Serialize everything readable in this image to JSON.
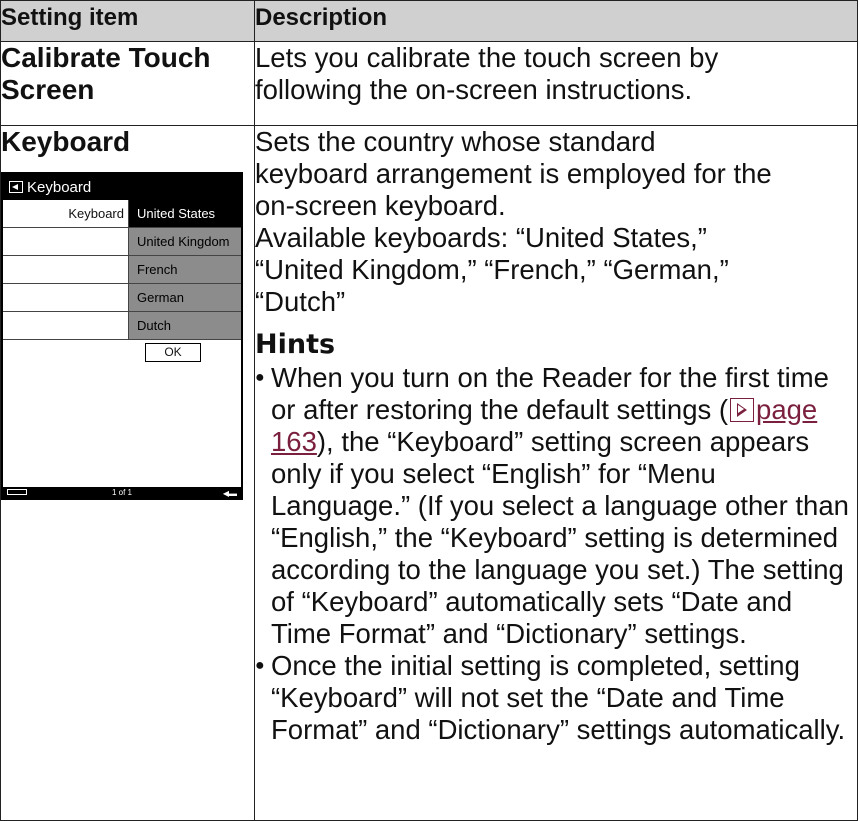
{
  "table": {
    "headers": {
      "item": "Setting item",
      "description": "Description"
    },
    "rows": [
      {
        "item_title": "Calibrate Touch Screen",
        "description_lines": [
          "Lets you calibrate the touch screen by",
          "following the on-screen instructions."
        ]
      },
      {
        "item_title": "Keyboard",
        "description_lines": [
          "Sets the country whose standard",
          "keyboard arrangement is employed for the",
          "on-screen keyboard.",
          "Available keyboards: “United States,”",
          "“United Kingdom,” “French,” “German,”",
          "“Dutch”"
        ],
        "hints_heading": "Hints",
        "hints": {
          "first": {
            "before_link": "When you turn on the Reader for the first time or after restoring the default settings (",
            "link": "page 163",
            "after_link": "), the “Keyboard” setting screen appears only if you select “English” for “Menu Language.” (If you select a language other than “English,” the “Keyboard” setting is determined according to the language you set.) The setting of “Keyboard” automatically sets “Date and Time Format” and “Dictionary” settings."
          },
          "second": "Once the initial setting is completed, setting “Keyboard” will not set the “Date and Time Format” and “Dictionary” settings automatically."
        }
      }
    ]
  },
  "device_screen": {
    "title": "Keyboard",
    "setting_label": "Keyboard",
    "options": [
      "United States",
      "United Kingdom",
      "French",
      "German",
      "Dutch"
    ],
    "selected_option": "United States",
    "ok_label": "OK",
    "page_indicator": "1 of 1",
    "icons": {
      "back": "back-icon",
      "battery": "battery-icon",
      "volume": "volume-icon",
      "reference": "reference-arrow-icon"
    }
  }
}
